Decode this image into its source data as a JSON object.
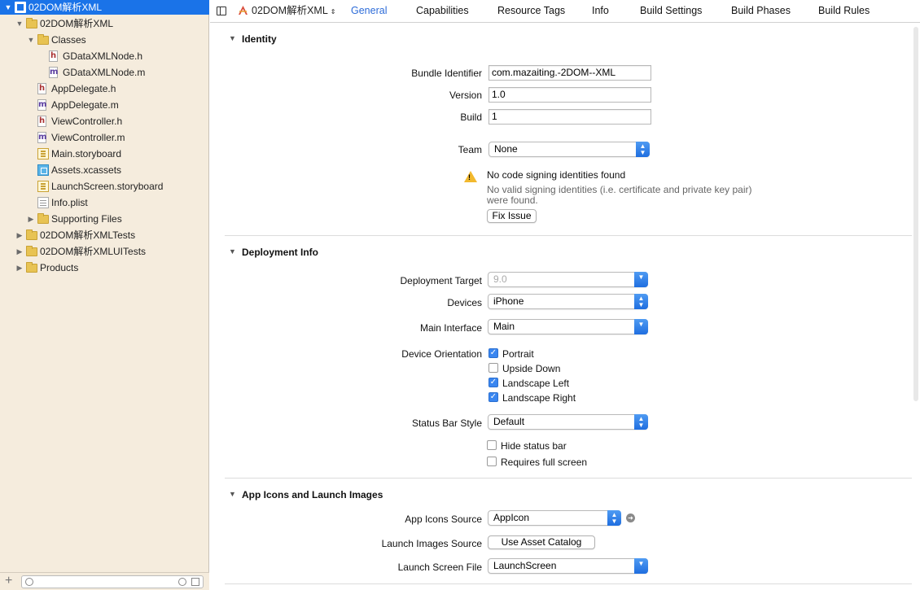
{
  "sidebar": {
    "items": [
      {
        "label": "02DOM解析XML",
        "icon": "project-icon",
        "disclosure": "open",
        "selected": true
      },
      {
        "label": "02DOM解析XML",
        "icon": "folder-icon",
        "disclosure": "open"
      },
      {
        "label": "Classes",
        "icon": "folder-icon",
        "disclosure": "open"
      },
      {
        "label": "GDataXMLNode.h",
        "icon": "header-file-icon",
        "glyph": "h"
      },
      {
        "label": "GDataXMLNode.m",
        "icon": "implementation-file-icon",
        "glyph": "m"
      },
      {
        "label": "AppDelegate.h",
        "icon": "header-file-icon",
        "glyph": "h"
      },
      {
        "label": "AppDelegate.m",
        "icon": "implementation-file-icon",
        "glyph": "m"
      },
      {
        "label": "ViewController.h",
        "icon": "header-file-icon",
        "glyph": "h"
      },
      {
        "label": "ViewController.m",
        "icon": "implementation-file-icon",
        "glyph": "m"
      },
      {
        "label": "Main.storyboard",
        "icon": "storyboard-icon"
      },
      {
        "label": "Assets.xcassets",
        "icon": "asset-catalog-icon"
      },
      {
        "label": "LaunchScreen.storyboard",
        "icon": "storyboard-icon"
      },
      {
        "label": "Info.plist",
        "icon": "plist-icon"
      },
      {
        "label": "Supporting Files",
        "icon": "folder-icon",
        "disclosure": "closed"
      },
      {
        "label": "02DOM解析XMLTests",
        "icon": "folder-icon",
        "disclosure": "closed"
      },
      {
        "label": "02DOM解析XMLUITests",
        "icon": "folder-icon",
        "disclosure": "closed"
      },
      {
        "label": "Products",
        "icon": "folder-icon",
        "disclosure": "closed"
      }
    ],
    "bottom": {
      "add": "+"
    }
  },
  "toolbar": {
    "target": "02DOM解析XML",
    "tabs": [
      "General",
      "Capabilities",
      "Resource Tags",
      "Info",
      "Build Settings",
      "Build Phases",
      "Build Rules"
    ],
    "active_tab": "General"
  },
  "identity": {
    "title": "Identity",
    "bundle_label": "Bundle Identifier",
    "bundle_value": "com.mazaiting.-2DOM--XML",
    "version_label": "Version",
    "version_value": "1.0",
    "build_label": "Build",
    "build_value": "1",
    "team_label": "Team",
    "team_value": "None",
    "warning_title": "No code signing identities found",
    "warning_line1": "No valid signing identities (i.e. certificate and private key pair)",
    "warning_line2": "were found.",
    "fix_button": "Fix Issue"
  },
  "deployment": {
    "title": "Deployment Info",
    "target_label": "Deployment Target",
    "target_value": "9.0",
    "devices_label": "Devices",
    "devices_value": "iPhone",
    "main_label": "Main Interface",
    "main_value": "Main",
    "orientation_label": "Device Orientation",
    "orientations": [
      {
        "label": "Portrait",
        "checked": true
      },
      {
        "label": "Upside Down",
        "checked": false
      },
      {
        "label": "Landscape Left",
        "checked": true
      },
      {
        "label": "Landscape Right",
        "checked": true
      }
    ],
    "status_label": "Status Bar Style",
    "status_value": "Default",
    "hide_status": {
      "label": "Hide status bar",
      "checked": false
    },
    "full_screen": {
      "label": "Requires full screen",
      "checked": false
    }
  },
  "app_icons": {
    "title": "App Icons and Launch Images",
    "icons_label": "App Icons Source",
    "icons_value": "AppIcon",
    "launch_images_label": "Launch Images Source",
    "launch_images_button": "Use Asset Catalog",
    "launch_file_label": "Launch Screen File",
    "launch_file_value": "LaunchScreen"
  },
  "colors": {
    "accent": "#1a73e8",
    "sidebar_bg": "#f5ecdd",
    "folder": "#e8c353"
  }
}
